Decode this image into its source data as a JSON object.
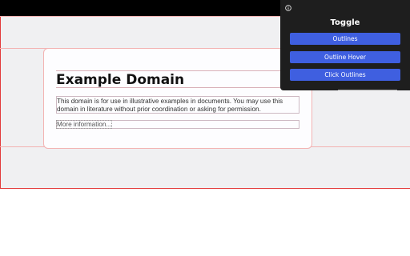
{
  "page": {
    "heading": "Example Domain",
    "paragraph": "This domain is for use in illustrative examples in documents. You may use this domain in literature without prior coordination or asking for permission.",
    "link_text": "More information..."
  },
  "panel": {
    "icon": "info-icon",
    "title": "Toggle",
    "buttons": [
      "Outlines",
      "Outline Hover",
      "Click Outlines"
    ]
  },
  "colors": {
    "outline": "#e33b3b",
    "panel_bg": "#1e1e1e",
    "button_bg": "#3f5fe0",
    "page_bg": "#f0f0f2"
  }
}
